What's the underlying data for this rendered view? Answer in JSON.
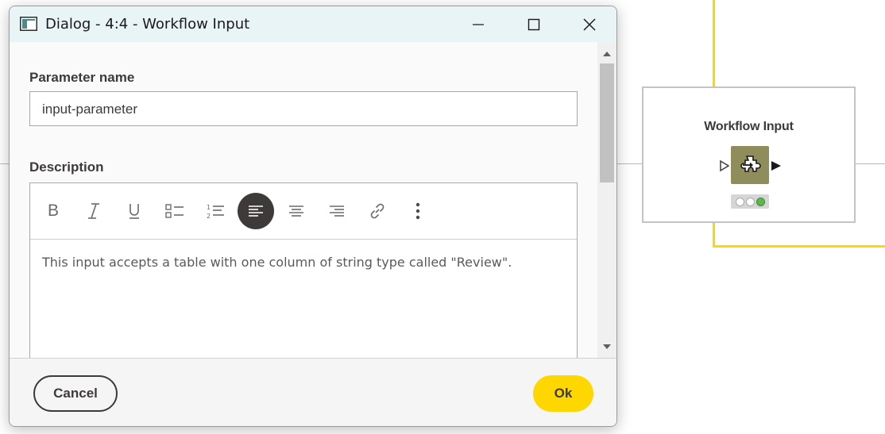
{
  "window": {
    "title": "Dialog - 4:4 - Workflow Input"
  },
  "form": {
    "parameter_name_label": "Parameter name",
    "parameter_name_value": "input-parameter",
    "description_label": "Description",
    "description_text": "This input accepts a table with one column of string type called \"Review\"."
  },
  "toolbar": {
    "bold": "B",
    "italic": "I",
    "underline": "U",
    "icons": [
      "bold-icon",
      "italic-icon",
      "underline-icon",
      "bullet-list-icon",
      "ordered-list-icon",
      "align-left-icon",
      "align-center-icon",
      "align-right-icon",
      "link-icon",
      "more-options-icon"
    ],
    "active": "align-left-icon"
  },
  "footer": {
    "cancel_label": "Cancel",
    "ok_label": "Ok"
  },
  "canvas": {
    "node_title": "Workflow Input",
    "node_status": [
      "idle",
      "idle",
      "green"
    ]
  },
  "colors": {
    "accent": "#ffd700",
    "text": "#3e3a39",
    "node_fill": "#8f8d5b",
    "titlebar": "#e8f4f6"
  }
}
